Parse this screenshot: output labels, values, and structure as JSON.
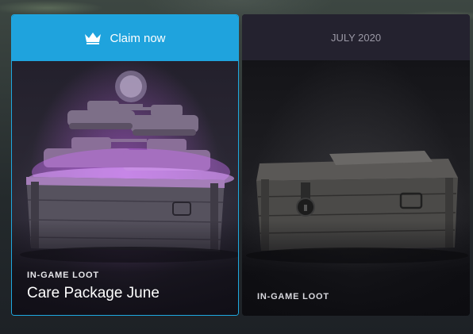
{
  "cards": [
    {
      "header_label": "Claim now",
      "header_icon": "crown-icon",
      "category": "IN-GAME LOOT",
      "title": "Care Package June",
      "accent": "#1fa3dd"
    },
    {
      "header_label": "JULY 2020",
      "category": "IN-GAME LOOT",
      "title": ""
    }
  ],
  "colors": {
    "claim_accent": "#1fa3dd",
    "glow": "#b85ae6",
    "locked_header": "#24222f"
  }
}
